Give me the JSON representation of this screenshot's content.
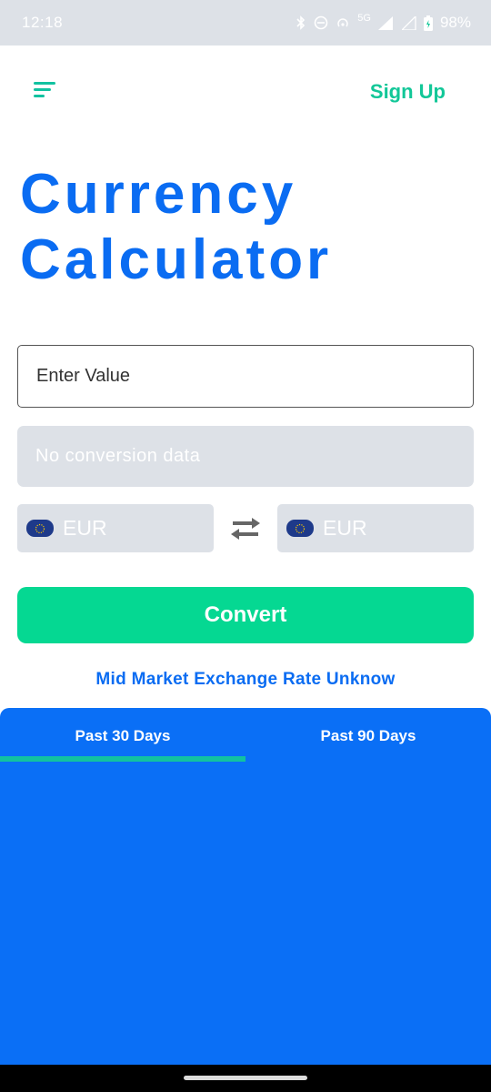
{
  "status_bar": {
    "time": "12:18",
    "network": "5G",
    "battery": "98%"
  },
  "header": {
    "signup_label": "Sign Up"
  },
  "title": {
    "line1": "Currency",
    "line2": "Calculator"
  },
  "input": {
    "placeholder": "Enter Value"
  },
  "result": {
    "text": "No conversion data"
  },
  "from_currency": {
    "code": "EUR",
    "flag_icon": "eu-flag-icon"
  },
  "to_currency": {
    "code": "EUR",
    "flag_icon": "eu-flag-icon"
  },
  "convert_label": "Convert",
  "rate_text": "Mid Market Exchange Rate Unknow",
  "tabs": [
    {
      "label": "Past 30 Days",
      "active": true
    },
    {
      "label": "Past 90 Days",
      "active": false
    }
  ],
  "colors": {
    "brand_blue": "#0a6cf2",
    "accent_green": "#05d892",
    "teal": "#12c2a0",
    "grey_fill": "#dde1e7"
  }
}
